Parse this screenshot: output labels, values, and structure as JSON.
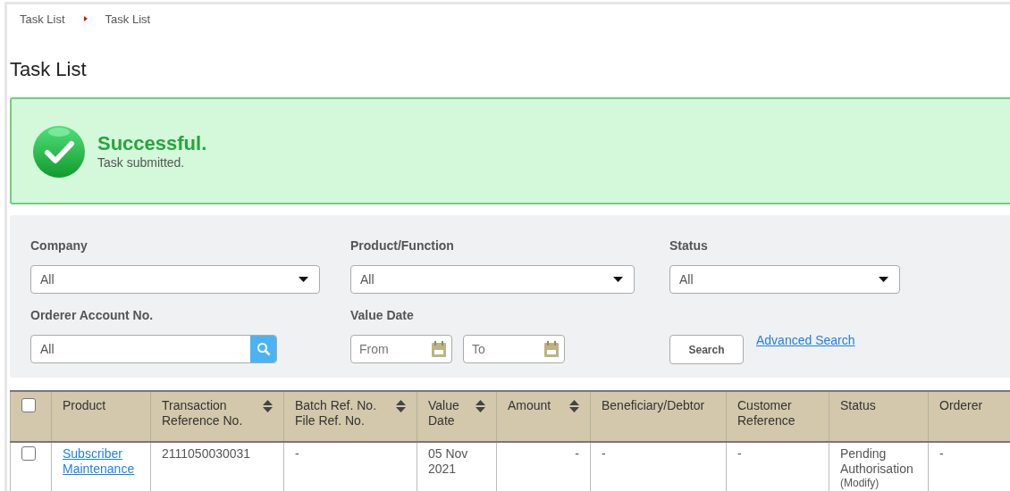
{
  "breadcrumb": [
    "Task List",
    "Task List"
  ],
  "title": "Task List",
  "alert": {
    "kind": "success",
    "heading": "Successful.",
    "message": "Task submitted."
  },
  "filters": [
    {
      "kind": "select",
      "label": "Company",
      "value": "All"
    },
    {
      "kind": "select",
      "label": "Product/Function",
      "value": "All"
    },
    {
      "kind": "select",
      "label": "Status",
      "value": "All"
    },
    {
      "kind": "search",
      "label": "Orderer Account No.",
      "value": "All"
    },
    {
      "kind": "daterange",
      "label": "Value Date",
      "from_placeholder": "From",
      "to_placeholder": "To"
    },
    {
      "kind": "actions",
      "button": "Search",
      "link": "Advanced Search"
    }
  ],
  "table": {
    "select_all_checked": false,
    "columns": [
      {
        "label": "Product",
        "sortable": false
      },
      {
        "label": "Transaction\nReference No.",
        "sortable": true
      },
      {
        "label": "Batch Ref. No.\nFile Ref. No.",
        "sortable": true
      },
      {
        "label": "Value\nDate",
        "sortable": true
      },
      {
        "label": "Amount",
        "sortable": true
      },
      {
        "label": "Beneficiary/Debtor",
        "sortable": false
      },
      {
        "label": "Customer\nReference",
        "sortable": false
      },
      {
        "label": "Status",
        "sortable": false
      },
      {
        "label": "Orderer",
        "sortable": false
      }
    ],
    "rows": [
      {
        "checked": false,
        "cells": [
          {
            "kind": "link",
            "text": "Subscriber\nMaintenance"
          },
          {
            "kind": "text",
            "text": "2111050030031"
          },
          {
            "kind": "text",
            "text": "-"
          },
          {
            "kind": "text",
            "text": "05 Nov\n2021"
          },
          {
            "kind": "number",
            "text": "-"
          },
          {
            "kind": "text",
            "text": "-"
          },
          {
            "kind": "text",
            "text": "-"
          },
          {
            "kind": "status",
            "text": "Pending\nAuthorisation",
            "note": "(Modify)"
          },
          {
            "kind": "text",
            "text": "-"
          }
        ]
      }
    ]
  }
}
